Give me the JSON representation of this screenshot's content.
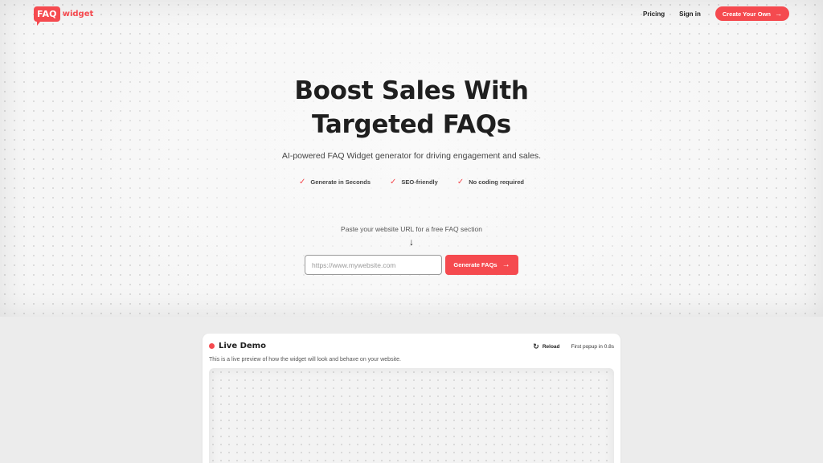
{
  "brand": {
    "logo_bubble": "FAQ",
    "logo_word": "widget",
    "accent_color": "#f54a4f"
  },
  "nav": {
    "pricing": "Pricing",
    "sign_in": "Sign in",
    "cta": "Create Your Own",
    "cta_icon": "arrow-right-icon"
  },
  "hero": {
    "headline_line1": "Boost Sales With",
    "headline_line2": "Targeted FAQs",
    "subtitle": "AI-powered FAQ Widget generator for driving engagement and sales.",
    "features": [
      "Generate in Seconds",
      "SEO-friendly",
      "No coding required"
    ],
    "feature_icon": "check-icon",
    "prompt": "Paste your website URL for a free FAQ section",
    "url_placeholder": "https://www.mywebsite.com",
    "url_value": "",
    "generate_label": "Generate FAQs"
  },
  "demo": {
    "title": "Live Demo",
    "reload_label": "Reload",
    "popup_note": "First popup in 0.8s",
    "description": "This is a live preview of how the widget will look and behave on your website."
  }
}
